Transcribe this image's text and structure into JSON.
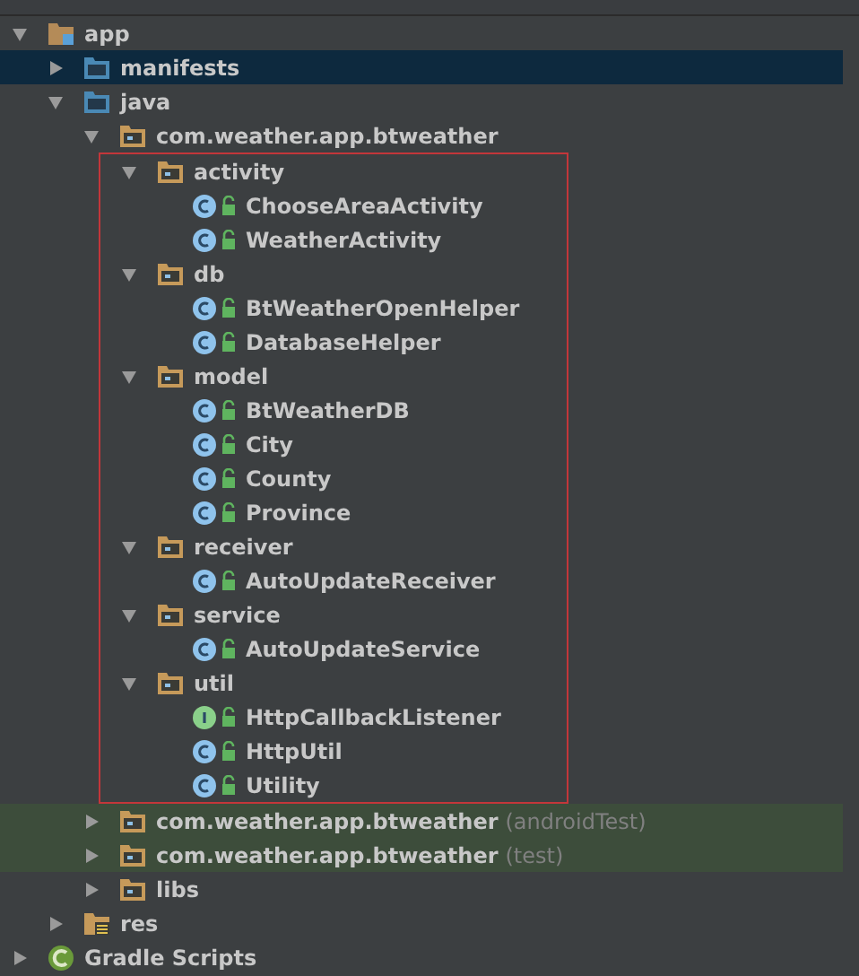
{
  "tree": [
    {
      "label": "app",
      "kind": "module",
      "expanded": true,
      "selected": false,
      "children": [
        {
          "label": "manifests",
          "kind": "folder",
          "expanded": false,
          "selected": true
        },
        {
          "label": "java",
          "kind": "folder",
          "expanded": true,
          "selected": false,
          "children": [
            {
              "label": "com.weather.app.btweather",
              "kind": "package",
              "expanded": true,
              "selected": false,
              "highlighted": true,
              "children": [
                {
                  "label": "activity",
                  "kind": "package",
                  "expanded": true,
                  "selected": false,
                  "children": [
                    {
                      "label": "ChooseAreaActivity",
                      "kind": "class",
                      "selected": false
                    },
                    {
                      "label": "WeatherActivity",
                      "kind": "class",
                      "selected": false
                    }
                  ]
                },
                {
                  "label": "db",
                  "kind": "package",
                  "expanded": true,
                  "selected": false,
                  "children": [
                    {
                      "label": "BtWeatherOpenHelper",
                      "kind": "class",
                      "selected": false
                    },
                    {
                      "label": "DatabaseHelper",
                      "kind": "class",
                      "selected": false
                    }
                  ]
                },
                {
                  "label": "model",
                  "kind": "package",
                  "expanded": true,
                  "selected": false,
                  "children": [
                    {
                      "label": "BtWeatherDB",
                      "kind": "class",
                      "selected": false
                    },
                    {
                      "label": "City",
                      "kind": "class",
                      "selected": false
                    },
                    {
                      "label": "County",
                      "kind": "class",
                      "selected": false
                    },
                    {
                      "label": "Province",
                      "kind": "class",
                      "selected": false
                    }
                  ]
                },
                {
                  "label": "receiver",
                  "kind": "package",
                  "expanded": true,
                  "selected": false,
                  "children": [
                    {
                      "label": "AutoUpdateReceiver",
                      "kind": "class",
                      "selected": false
                    }
                  ]
                },
                {
                  "label": "service",
                  "kind": "package",
                  "expanded": true,
                  "selected": false,
                  "children": [
                    {
                      "label": "AutoUpdateService",
                      "kind": "class",
                      "selected": false
                    }
                  ]
                },
                {
                  "label": "util",
                  "kind": "package",
                  "expanded": true,
                  "selected": false,
                  "children": [
                    {
                      "label": "HttpCallbackListener",
                      "kind": "interface",
                      "selected": false
                    },
                    {
                      "label": "HttpUtil",
                      "kind": "class",
                      "selected": false
                    },
                    {
                      "label": "Utility",
                      "kind": "class",
                      "selected": false
                    }
                  ]
                }
              ]
            },
            {
              "label": "com.weather.app.btweather",
              "suffix": "(androidTest)",
              "kind": "package",
              "expanded": false,
              "selected": false,
              "test": true
            },
            {
              "label": "com.weather.app.btweather",
              "suffix": "(test)",
              "kind": "package",
              "expanded": false,
              "selected": false,
              "test": true
            },
            {
              "label": "libs",
              "kind": "package",
              "expanded": false,
              "selected": false
            }
          ]
        },
        {
          "label": "res",
          "kind": "resources",
          "expanded": false,
          "selected": false
        }
      ]
    },
    {
      "label": "Gradle Scripts",
      "kind": "gradle",
      "expanded": false,
      "selected": false
    }
  ]
}
